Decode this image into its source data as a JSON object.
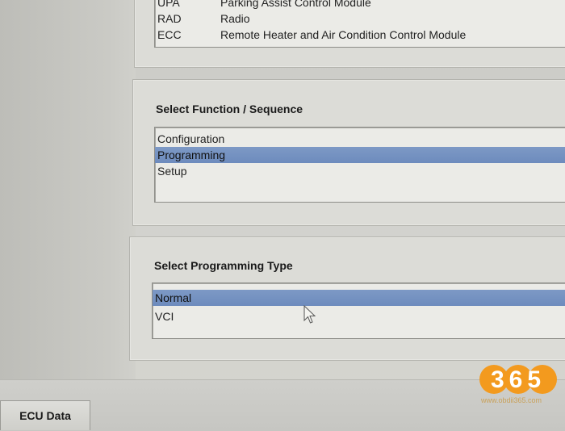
{
  "module_list": {
    "rows": [
      {
        "code": "UPA",
        "name": "Parking Assist Control Module"
      },
      {
        "code": "RAD",
        "name": "Radio"
      },
      {
        "code": "ECC",
        "name": "Remote Heater and Air Condition Control Module"
      }
    ]
  },
  "function_section": {
    "title": "Select Function / Sequence",
    "options": [
      "Configuration",
      "Programming",
      "Setup"
    ],
    "selected": "Programming"
  },
  "programming_type_section": {
    "title": "Select Programming Type",
    "options": [
      "Normal",
      "VCI"
    ],
    "selected": "Normal"
  },
  "bottom_tabs": {
    "ecu_data_label": "ECU Data"
  },
  "watermark": {
    "logo_text": "365",
    "url": "www.obdii365.com"
  },
  "colors": {
    "selection": "#6d8bbd",
    "panel": "#dcdcd7",
    "listbox": "#ebebe7",
    "watermark_orange": "#f39a1e"
  }
}
